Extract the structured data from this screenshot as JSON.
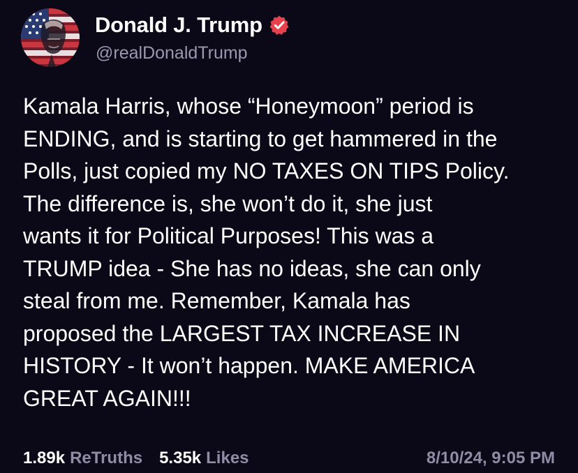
{
  "author": {
    "name": "Donald J. Trump",
    "handle": "@realDonaldTrump",
    "verified": true,
    "avatar_icon": "flag-portrait-avatar"
  },
  "post": {
    "lines": [
      "Kamala Harris, whose “Honeymoon” period is",
      "ENDING, and is starting to get hammered in the",
      "Polls, just copied my NO TAXES ON TIPS Policy.",
      "The difference is, she won’t do it, she just",
      "wants it for Political Purposes! This was a",
      "TRUMP idea - She has no ideas, she can only",
      "steal from me. Remember, Kamala has",
      "proposed the LARGEST TAX INCREASE IN",
      "HISTORY - It won’t happen. MAKE AMERICA",
      "GREAT AGAIN!!!"
    ]
  },
  "stats": {
    "retruths_count": "1.89k",
    "retruths_label": "ReTruths",
    "likes_count": "5.35k",
    "likes_label": "Likes"
  },
  "timestamp": "8/10/24, 9:05 PM",
  "colors": {
    "background": "#0b0817",
    "text": "#ffffff",
    "muted": "#8f8ca6",
    "verified_badge": "#e5424d"
  }
}
